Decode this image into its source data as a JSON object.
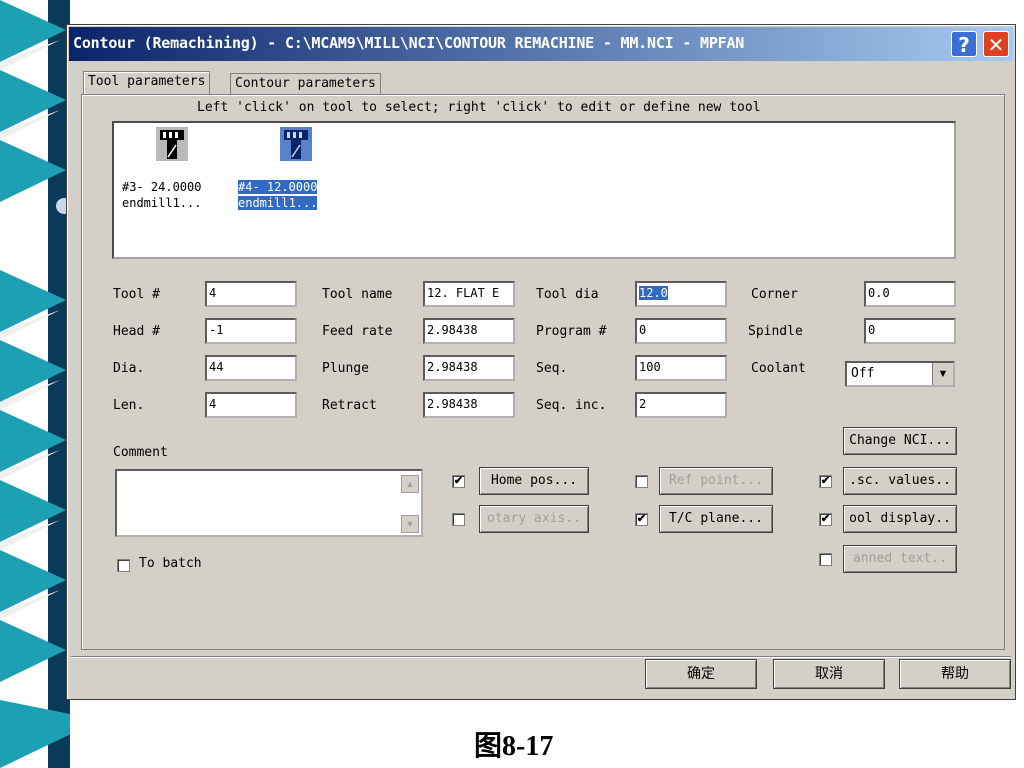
{
  "window": {
    "title": "Contour (Remachining) - C:\\MCAM9\\MILL\\NCI\\CONTOUR REMACHINE - MM.NCI - MPFAN"
  },
  "tabs": [
    {
      "label": "Tool parameters",
      "active": true
    },
    {
      "label": "Contour parameters",
      "active": false
    }
  ],
  "tool_list": {
    "hint": "Left 'click' on tool to select; right 'click' to edit or define new tool",
    "tools": [
      {
        "line1": "#3- 24.0000",
        "line2": "endmill1...",
        "selected": false
      },
      {
        "line1": "#4- 12.0000",
        "line2": "endmill1...",
        "selected": true
      }
    ]
  },
  "fields": {
    "tool_num": {
      "label": "Tool #",
      "value": "4"
    },
    "head_num": {
      "label": "Head #",
      "value": "-1"
    },
    "dia": {
      "label": "Dia.",
      "value": "44"
    },
    "len": {
      "label": "Len.",
      "value": "4"
    },
    "tool_name": {
      "label": "Tool name",
      "value": "12. FLAT E"
    },
    "feed_rate": {
      "label": "Feed rate",
      "value": "2.98438"
    },
    "plunge": {
      "label": "Plunge",
      "value": "2.98438"
    },
    "retract": {
      "label": "Retract",
      "value": "2.98438"
    },
    "tool_dia": {
      "label": "Tool dia",
      "value": "12.0"
    },
    "program_num": {
      "label": "Program #",
      "value": "0"
    },
    "seq": {
      "label": "Seq.",
      "value": "100"
    },
    "seq_inc": {
      "label": "Seq. inc.",
      "value": "2"
    },
    "corner": {
      "label": "Corner",
      "value": "0.0"
    },
    "spindle": {
      "label": "Spindle",
      "value": "0"
    },
    "coolant": {
      "label": "Coolant",
      "value": "Off"
    }
  },
  "comment": {
    "label": "Comment",
    "value": ""
  },
  "buttons": {
    "home_pos": {
      "label": "Home pos...",
      "checked": true,
      "enabled": true
    },
    "rotary_axis": {
      "label": "otary axis..",
      "checked": false,
      "enabled": false
    },
    "ref_point": {
      "label": "Ref point...",
      "checked": false,
      "enabled": false
    },
    "tc_plane": {
      "label": "T/C plane...",
      "checked": true,
      "enabled": true
    },
    "change_nci": {
      "label": "Change NCI..."
    },
    "misc_values": {
      "label": ".sc. values..",
      "checked": true,
      "enabled": true
    },
    "tool_display": {
      "label": "ool display..",
      "checked": true,
      "enabled": true
    },
    "canned_text": {
      "label": "anned text..",
      "checked": false,
      "enabled": false
    }
  },
  "to_batch": {
    "label": "To batch",
    "checked": false
  },
  "footer": {
    "ok": "确定",
    "cancel": "取消",
    "help": "帮助"
  },
  "caption": "图8-17",
  "colors": {
    "title_start": "#0a246a",
    "title_end": "#a6caf0",
    "selection": "#316ac5",
    "dialog_bg": "#d4d0c8",
    "deco_strip": "#1ea0b4"
  }
}
